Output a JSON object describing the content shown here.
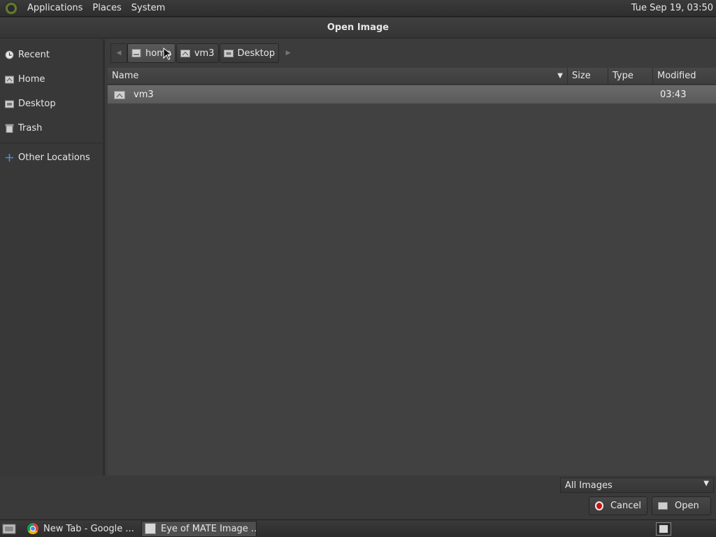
{
  "top_panel": {
    "menus": [
      "Applications",
      "Places",
      "System"
    ],
    "clock": "Tue Sep 19, 03:50"
  },
  "dialog": {
    "title": "Open Image",
    "sidebar": {
      "items": [
        {
          "label": "Recent",
          "icon": "recent-icon"
        },
        {
          "label": "Home",
          "icon": "home-icon"
        },
        {
          "label": "Desktop",
          "icon": "desktop-folder-icon"
        },
        {
          "label": "Trash",
          "icon": "trash-icon"
        }
      ],
      "other": {
        "label": "Other Locations",
        "icon": "plus-icon"
      }
    },
    "pathbar": {
      "crumbs": [
        {
          "label": "home",
          "icon": "drive-icon",
          "active": true
        },
        {
          "label": "vm3",
          "icon": "home-icon",
          "active": false
        },
        {
          "label": "Desktop",
          "icon": "desktop-folder-icon",
          "active": false
        }
      ]
    },
    "columns": {
      "name": "Name",
      "size": "Size",
      "type": "Type",
      "modified": "Modified"
    },
    "files": [
      {
        "name": "vm3",
        "size": "",
        "type": "",
        "modified": "03:43",
        "icon": "home-folder-icon"
      }
    ],
    "filter": "All Images",
    "buttons": {
      "cancel": "Cancel",
      "open": "Open"
    }
  },
  "taskbar": {
    "tasks": [
      {
        "label": "New Tab - Google ...",
        "icon": "chrome-icon",
        "active": false
      },
      {
        "label": "Eye of MATE Image ...",
        "icon": "image-viewer-icon",
        "active": true
      }
    ]
  }
}
